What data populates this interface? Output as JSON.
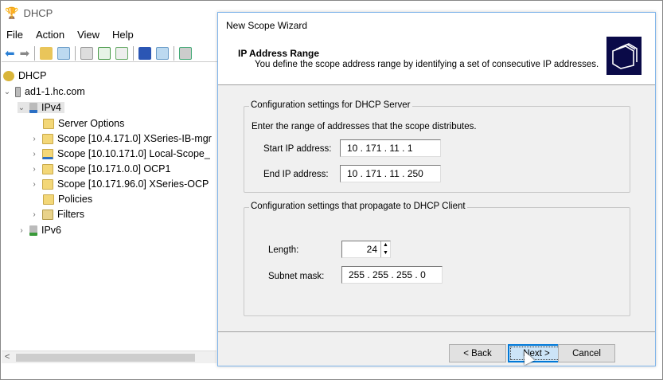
{
  "app": {
    "title": "DHCP",
    "menu": [
      "File",
      "Action",
      "View",
      "Help"
    ]
  },
  "tree": {
    "root": "DHCP",
    "server": "ad1-1.hc.com",
    "ipv4": "IPv4",
    "items": [
      "Server Options",
      "Scope [10.4.171.0] XSeries-IB-mgr",
      "Scope [10.10.171.0] Local-Scope_",
      "Scope [10.171.0.0] OCP1",
      "Scope [10.171.96.0] XSeries-OCP",
      "Policies",
      "Filters"
    ],
    "ipv6": "IPv6"
  },
  "wizard": {
    "title": "New Scope Wizard",
    "heading": "IP Address Range",
    "subheading": "You define the scope address range by identifying a set of consecutive IP addresses.",
    "server_group": "Configuration settings for DHCP Server",
    "server_desc": "Enter the range of addresses that the scope distributes.",
    "start_label": "Start IP address:",
    "start_value": "10 . 171 . 11 . 1",
    "end_label": "End IP address:",
    "end_value": "10 . 171 . 11 . 250",
    "client_group": "Configuration settings that propagate to DHCP Client",
    "length_label": "Length:",
    "length_value": "24",
    "mask_label": "Subnet mask:",
    "mask_value": "255 . 255 . 255 . 0",
    "back": "< Back",
    "next": "Next >",
    "cancel": "Cancel"
  }
}
